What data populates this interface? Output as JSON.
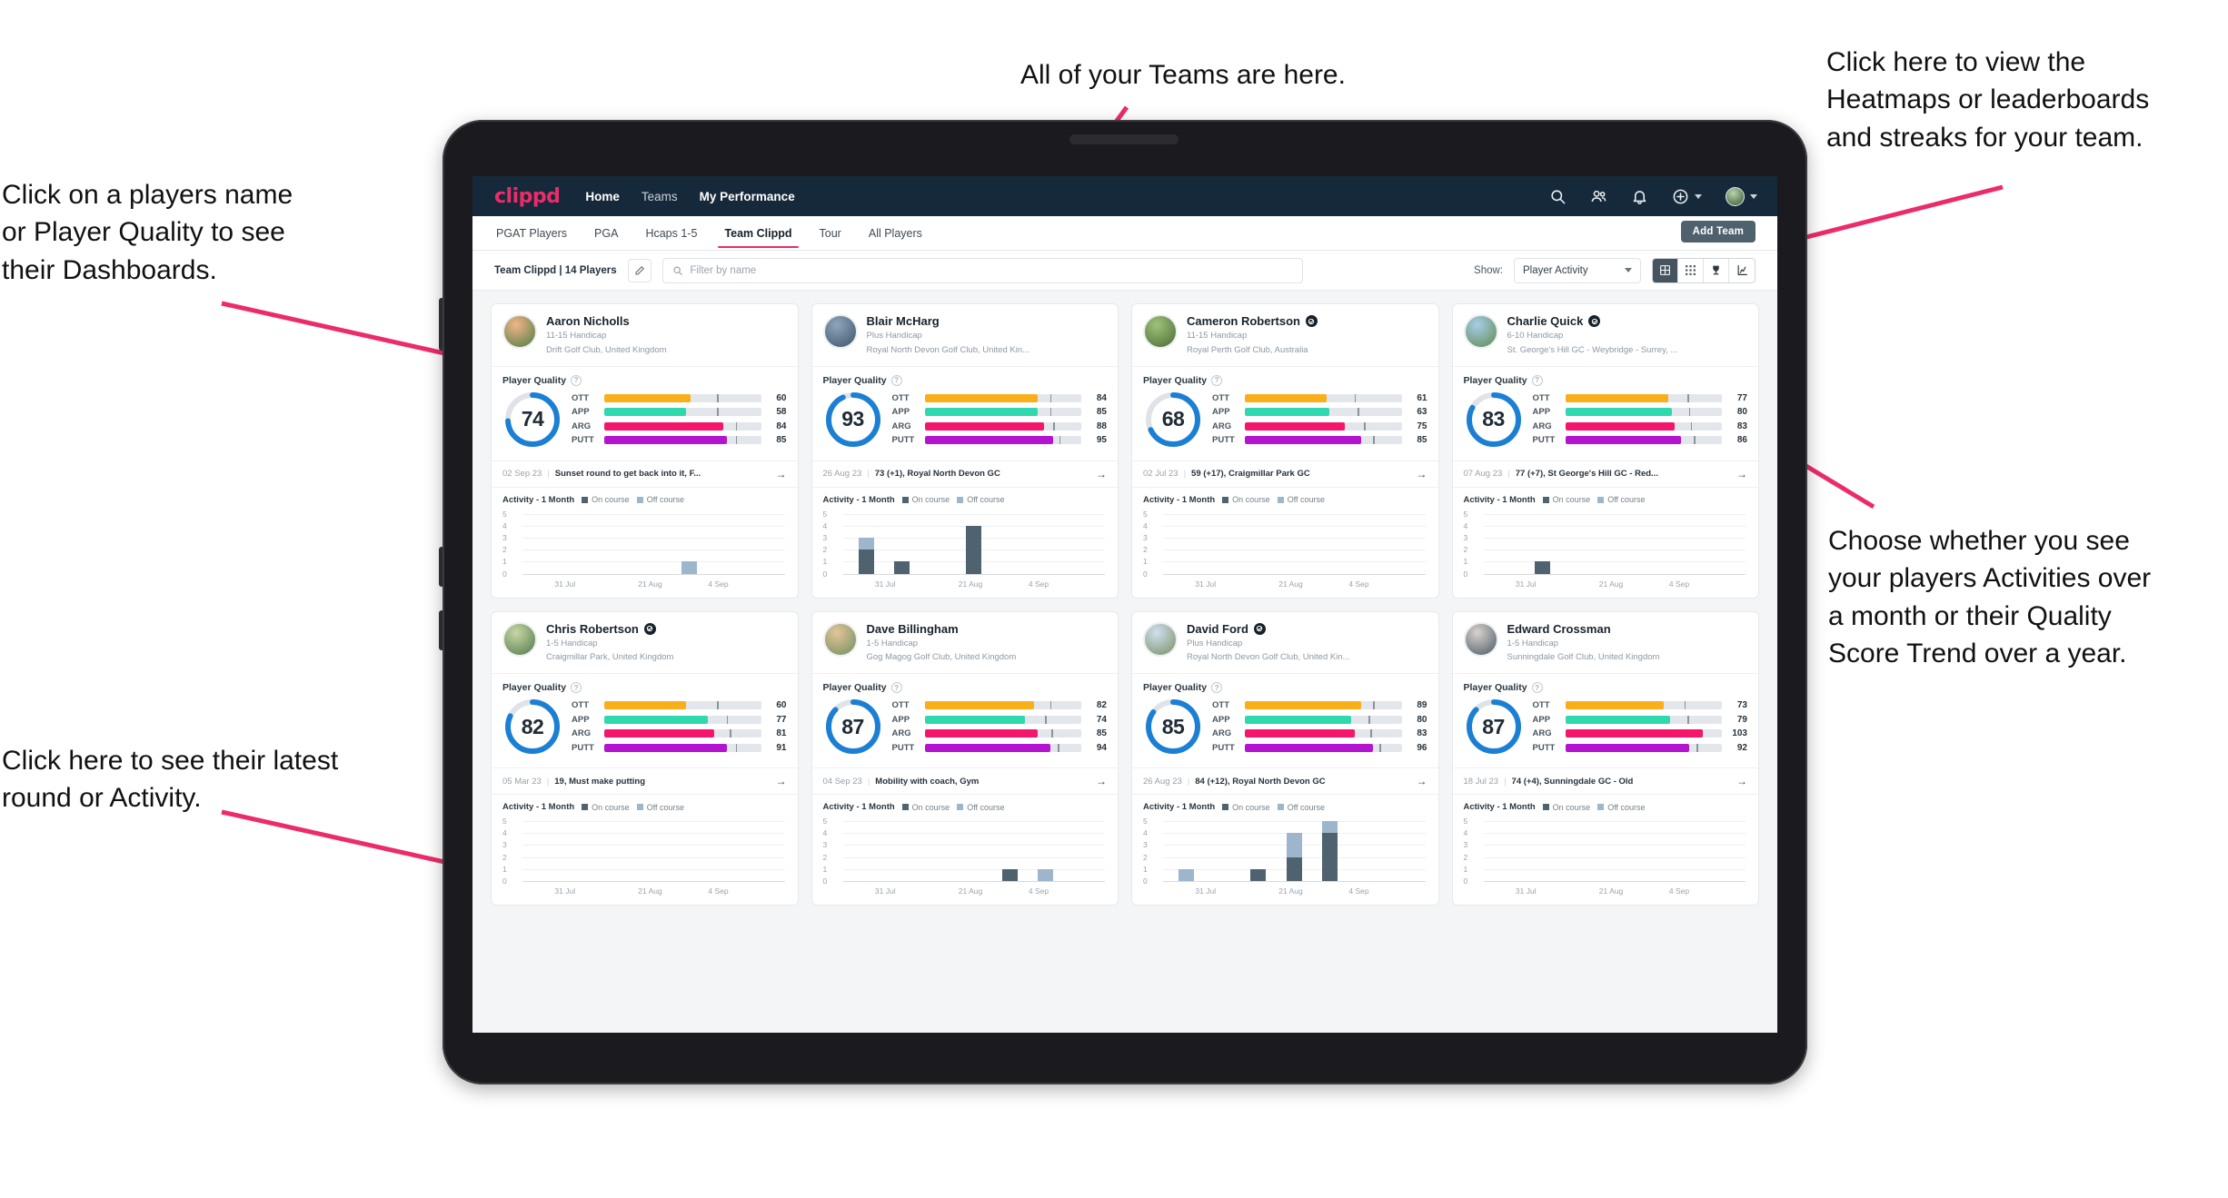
{
  "annotations": [
    {
      "id": "teams-note",
      "text": "All of your Teams are here."
    },
    {
      "id": "heatmaps-note",
      "text": "Click here to view the\nHeatmaps or leaderboards\nand streaks for your team."
    },
    {
      "id": "dashboards-note",
      "text": "Click on a players name\nor Player Quality to see\ntheir Dashboards."
    },
    {
      "id": "activity-note",
      "text": "Choose whether you see\nyour players Activities over\na month or their Quality\nScore Trend over a year."
    },
    {
      "id": "latest-round-note",
      "text": "Click here to see their latest\nround or Activity."
    }
  ],
  "colors": {
    "brand_pink": "#ec2c6a",
    "header_bg": "#15293a",
    "ott": "#f9ae1b",
    "app": "#2fd9b0",
    "arg": "#f5166c",
    "putt": "#b414cf",
    "ring": "#1b7fd4",
    "on_course": "#4f626f",
    "off_course": "#9db6cb",
    "annotation_arrow": "#ec2c6a"
  },
  "appbar": {
    "brand": "clippd",
    "nav": [
      {
        "label": "Home",
        "active": true
      },
      {
        "label": "Teams",
        "active": false
      },
      {
        "label": "My Performance",
        "active": true
      }
    ],
    "icons": [
      "search-icon",
      "people-icon",
      "bell-icon",
      "plus-circle-icon",
      "avatar"
    ]
  },
  "tabs": [
    {
      "label": "PGAT Players",
      "active": false
    },
    {
      "label": "PGA",
      "active": false
    },
    {
      "label": "Hcaps 1-5",
      "active": false
    },
    {
      "label": "Team Clippd",
      "active": true
    },
    {
      "label": "Tour",
      "active": false
    },
    {
      "label": "All Players",
      "active": false
    }
  ],
  "add_team_label": "Add Team",
  "filterbar": {
    "team_label": "Team Clippd | 14 Players",
    "edit_icon": "pencil-icon",
    "search_placeholder": "Filter by name",
    "search_value": "",
    "show_label": "Show:",
    "show_value": "Player Activity",
    "view_buttons": [
      "split-view-icon",
      "grid-view-icon",
      "trophy-icon",
      "streak-icon"
    ],
    "active_view_index": 0
  },
  "chart_common": {
    "title": "Activity - 1 Month",
    "legend": [
      "On course",
      "Off course"
    ],
    "y_ticks": [
      "5",
      "4",
      "3",
      "2",
      "1",
      "0"
    ],
    "ylim": [
      0,
      5
    ],
    "x_ticks": [
      "31 Jul",
      "21 Aug",
      "4 Sep"
    ],
    "slots": 7
  },
  "metric_labels": [
    "OTT",
    "APP",
    "ARG",
    "PUTT"
  ],
  "player_quality_label": "Player Quality",
  "players": [
    {
      "name": "Aaron Nicholls",
      "verified": false,
      "handicap": "11-15 Handicap",
      "club": "Drift Golf Club, United Kingdom",
      "avatar_from": "#f2b48a",
      "avatar_to": "#4b7d3f",
      "quality": 74,
      "metrics": [
        {
          "label": "OTT",
          "value": 60,
          "fill": 55,
          "tick": 72
        },
        {
          "label": "APP",
          "value": 58,
          "fill": 52,
          "tick": 72
        },
        {
          "label": "ARG",
          "value": 84,
          "fill": 76,
          "tick": 84
        },
        {
          "label": "PUTT",
          "value": 85,
          "fill": 78,
          "tick": 84
        }
      ],
      "round": {
        "date": "02 Sep 23",
        "text": "Sunset round to get back into it, F..."
      },
      "chart_data": {
        "type": "bar",
        "title": "Activity - 1 Month",
        "categories": [
          "31 Jul",
          "",
          "",
          "21 Aug",
          "",
          "4 Sep",
          ""
        ],
        "series": [
          {
            "name": "On course",
            "values": [
              0,
              0,
              0,
              0,
              0,
              0,
              0
            ]
          },
          {
            "name": "Off course",
            "values": [
              0,
              0,
              0,
              0,
              1,
              0,
              0
            ]
          }
        ],
        "ylim": [
          0,
          5
        ],
        "ylabel": "",
        "xlabel": "",
        "grid": true
      }
    },
    {
      "name": "Blair McHarg",
      "verified": false,
      "handicap": "Plus Handicap",
      "club": "Royal North Devon Golf Club, United Kin...",
      "avatar_from": "#8fa5bd",
      "avatar_to": "#3e5569",
      "quality": 93,
      "metrics": [
        {
          "label": "OTT",
          "value": 84,
          "fill": 72,
          "tick": 80
        },
        {
          "label": "APP",
          "value": 85,
          "fill": 72,
          "tick": 80
        },
        {
          "label": "ARG",
          "value": 88,
          "fill": 76,
          "tick": 82
        },
        {
          "label": "PUTT",
          "value": 95,
          "fill": 82,
          "tick": 86
        }
      ],
      "round": {
        "date": "26 Aug 23",
        "text": "73 (+1), Royal North Devon GC"
      },
      "chart_data": {
        "type": "bar",
        "title": "Activity - 1 Month",
        "categories": [
          "31 Jul",
          "",
          "",
          "21 Aug",
          "",
          "4 Sep",
          ""
        ],
        "series": [
          {
            "name": "On course",
            "values": [
              2,
              1,
              0,
              4,
              0,
              0,
              0
            ]
          },
          {
            "name": "Off course",
            "values": [
              1,
              0,
              0,
              0,
              0,
              0,
              0
            ]
          }
        ],
        "ylim": [
          0,
          5
        ],
        "ylabel": "",
        "xlabel": "",
        "grid": true
      }
    },
    {
      "name": "Cameron Robertson",
      "verified": true,
      "handicap": "11-15 Handicap",
      "club": "Royal Perth Golf Club, Australia",
      "avatar_from": "#9fc27a",
      "avatar_to": "#4a6b33",
      "quality": 68,
      "metrics": [
        {
          "label": "OTT",
          "value": 61,
          "fill": 52,
          "tick": 70
        },
        {
          "label": "APP",
          "value": 63,
          "fill": 54,
          "tick": 72
        },
        {
          "label": "ARG",
          "value": 75,
          "fill": 64,
          "tick": 76
        },
        {
          "label": "PUTT",
          "value": 85,
          "fill": 74,
          "tick": 82
        }
      ],
      "round": {
        "date": "02 Jul 23",
        "text": "59 (+17), Craigmillar Park GC"
      },
      "chart_data": {
        "type": "bar",
        "title": "Activity - 1 Month",
        "categories": [
          "31 Jul",
          "",
          "",
          "21 Aug",
          "",
          "4 Sep",
          ""
        ],
        "series": [
          {
            "name": "On course",
            "values": [
              0,
              0,
              0,
              0,
              0,
              0,
              0
            ]
          },
          {
            "name": "Off course",
            "values": [
              0,
              0,
              0,
              0,
              0,
              0,
              0
            ]
          }
        ],
        "ylim": [
          0,
          5
        ],
        "ylabel": "",
        "xlabel": "",
        "grid": true
      }
    },
    {
      "name": "Charlie Quick",
      "verified": true,
      "handicap": "6-10 Handicap",
      "club": "St. George's Hill GC - Weybridge - Surrey, ...",
      "avatar_from": "#a8cde8",
      "avatar_to": "#5d8a4e",
      "quality": 83,
      "metrics": [
        {
          "label": "OTT",
          "value": 77,
          "fill": 66,
          "tick": 78
        },
        {
          "label": "APP",
          "value": 80,
          "fill": 68,
          "tick": 79
        },
        {
          "label": "ARG",
          "value": 83,
          "fill": 70,
          "tick": 80
        },
        {
          "label": "PUTT",
          "value": 86,
          "fill": 74,
          "tick": 82
        }
      ],
      "round": {
        "date": "07 Aug 23",
        "text": "77 (+7), St George's Hill GC - Red..."
      },
      "chart_data": {
        "type": "bar",
        "title": "Activity - 1 Month",
        "categories": [
          "31 Jul",
          "",
          "",
          "21 Aug",
          "",
          "4 Sep",
          ""
        ],
        "series": [
          {
            "name": "On course",
            "values": [
              0,
              1,
              0,
              0,
              0,
              0,
              0
            ]
          },
          {
            "name": "Off course",
            "values": [
              0,
              0,
              0,
              0,
              0,
              0,
              0
            ]
          }
        ],
        "ylim": [
          0,
          5
        ],
        "ylabel": "",
        "xlabel": "",
        "grid": true
      }
    },
    {
      "name": "Chris Robertson",
      "verified": true,
      "handicap": "1-5 Handicap",
      "club": "Craigmillar Park, United Kingdom",
      "avatar_from": "#c9d6a5",
      "avatar_to": "#4f7a4a",
      "quality": 82,
      "metrics": [
        {
          "label": "OTT",
          "value": 60,
          "fill": 52,
          "tick": 72
        },
        {
          "label": "APP",
          "value": 77,
          "fill": 66,
          "tick": 78
        },
        {
          "label": "ARG",
          "value": 81,
          "fill": 70,
          "tick": 80
        },
        {
          "label": "PUTT",
          "value": 91,
          "fill": 78,
          "tick": 84
        }
      ],
      "round": {
        "date": "05 Mar 23",
        "text": "19, Must make putting"
      },
      "chart_data": {
        "type": "bar",
        "title": "Activity - 1 Month",
        "categories": [
          "31 Jul",
          "",
          "",
          "21 Aug",
          "",
          "4 Sep",
          ""
        ],
        "series": [
          {
            "name": "On course",
            "values": [
              0,
              0,
              0,
              0,
              0,
              0,
              0
            ]
          },
          {
            "name": "Off course",
            "values": [
              0,
              0,
              0,
              0,
              0,
              0,
              0
            ]
          }
        ],
        "ylim": [
          0,
          5
        ],
        "ylabel": "",
        "xlabel": "",
        "grid": true
      }
    },
    {
      "name": "Dave Billingham",
      "verified": false,
      "handicap": "1-5 Handicap",
      "club": "Gog Magog Golf Club, United Kingdom",
      "avatar_from": "#e5c49a",
      "avatar_to": "#6d8f5e",
      "quality": 87,
      "metrics": [
        {
          "label": "OTT",
          "value": 82,
          "fill": 70,
          "tick": 80
        },
        {
          "label": "APP",
          "value": 74,
          "fill": 64,
          "tick": 77
        },
        {
          "label": "ARG",
          "value": 85,
          "fill": 72,
          "tick": 81
        },
        {
          "label": "PUTT",
          "value": 94,
          "fill": 80,
          "tick": 85
        }
      ],
      "round": {
        "date": "04 Sep 23",
        "text": "Mobility with coach, Gym"
      },
      "chart_data": {
        "type": "bar",
        "title": "Activity - 1 Month",
        "categories": [
          "31 Jul",
          "",
          "",
          "21 Aug",
          "",
          "4 Sep",
          ""
        ],
        "series": [
          {
            "name": "On course",
            "values": [
              0,
              0,
              0,
              0,
              1,
              0,
              0
            ]
          },
          {
            "name": "Off course",
            "values": [
              0,
              0,
              0,
              0,
              0,
              1,
              0
            ]
          }
        ],
        "ylim": [
          0,
          5
        ],
        "ylabel": "",
        "xlabel": "",
        "grid": true
      }
    },
    {
      "name": "David Ford",
      "verified": true,
      "handicap": "Plus Handicap",
      "club": "Royal North Devon Golf Club, United Kin...",
      "avatar_from": "#cfe0ef",
      "avatar_to": "#7b8f63",
      "quality": 85,
      "metrics": [
        {
          "label": "OTT",
          "value": 89,
          "fill": 74,
          "tick": 82
        },
        {
          "label": "APP",
          "value": 80,
          "fill": 68,
          "tick": 79
        },
        {
          "label": "ARG",
          "value": 83,
          "fill": 70,
          "tick": 80
        },
        {
          "label": "PUTT",
          "value": 96,
          "fill": 82,
          "tick": 86
        }
      ],
      "round": {
        "date": "26 Aug 23",
        "text": "84 (+12), Royal North Devon GC"
      },
      "chart_data": {
        "type": "bar",
        "title": "Activity - 1 Month",
        "categories": [
          "31 Jul",
          "",
          "",
          "21 Aug",
          "",
          "4 Sep",
          ""
        ],
        "series": [
          {
            "name": "On course",
            "values": [
              0,
              0,
              1,
              2,
              4,
              0,
              0
            ]
          },
          {
            "name": "Off course",
            "values": [
              1,
              0,
              0,
              2,
              1,
              0,
              0
            ]
          }
        ],
        "ylim": [
          0,
          5
        ],
        "ylabel": "",
        "xlabel": "",
        "grid": true
      }
    },
    {
      "name": "Edward Crossman",
      "verified": false,
      "handicap": "1-5 Handicap",
      "club": "Sunningdale Golf Club, United Kingdom",
      "avatar_from": "#d8d2cd",
      "avatar_to": "#4a5a66",
      "quality": 87,
      "metrics": [
        {
          "label": "OTT",
          "value": 73,
          "fill": 63,
          "tick": 76
        },
        {
          "label": "APP",
          "value": 79,
          "fill": 67,
          "tick": 78
        },
        {
          "label": "ARG",
          "value": 103,
          "fill": 88,
          "tick": 0
        },
        {
          "label": "PUTT",
          "value": 92,
          "fill": 79,
          "tick": 84
        }
      ],
      "round": {
        "date": "18 Jul 23",
        "text": "74 (+4), Sunningdale GC - Old"
      },
      "chart_data": {
        "type": "bar",
        "title": "Activity - 1 Month",
        "categories": [
          "31 Jul",
          "",
          "",
          "21 Aug",
          "",
          "4 Sep",
          ""
        ],
        "series": [
          {
            "name": "On course",
            "values": [
              0,
              0,
              0,
              0,
              0,
              0,
              0
            ]
          },
          {
            "name": "Off course",
            "values": [
              0,
              0,
              0,
              0,
              0,
              0,
              0
            ]
          }
        ],
        "ylim": [
          0,
          5
        ],
        "ylabel": "",
        "xlabel": "",
        "grid": true
      }
    }
  ]
}
